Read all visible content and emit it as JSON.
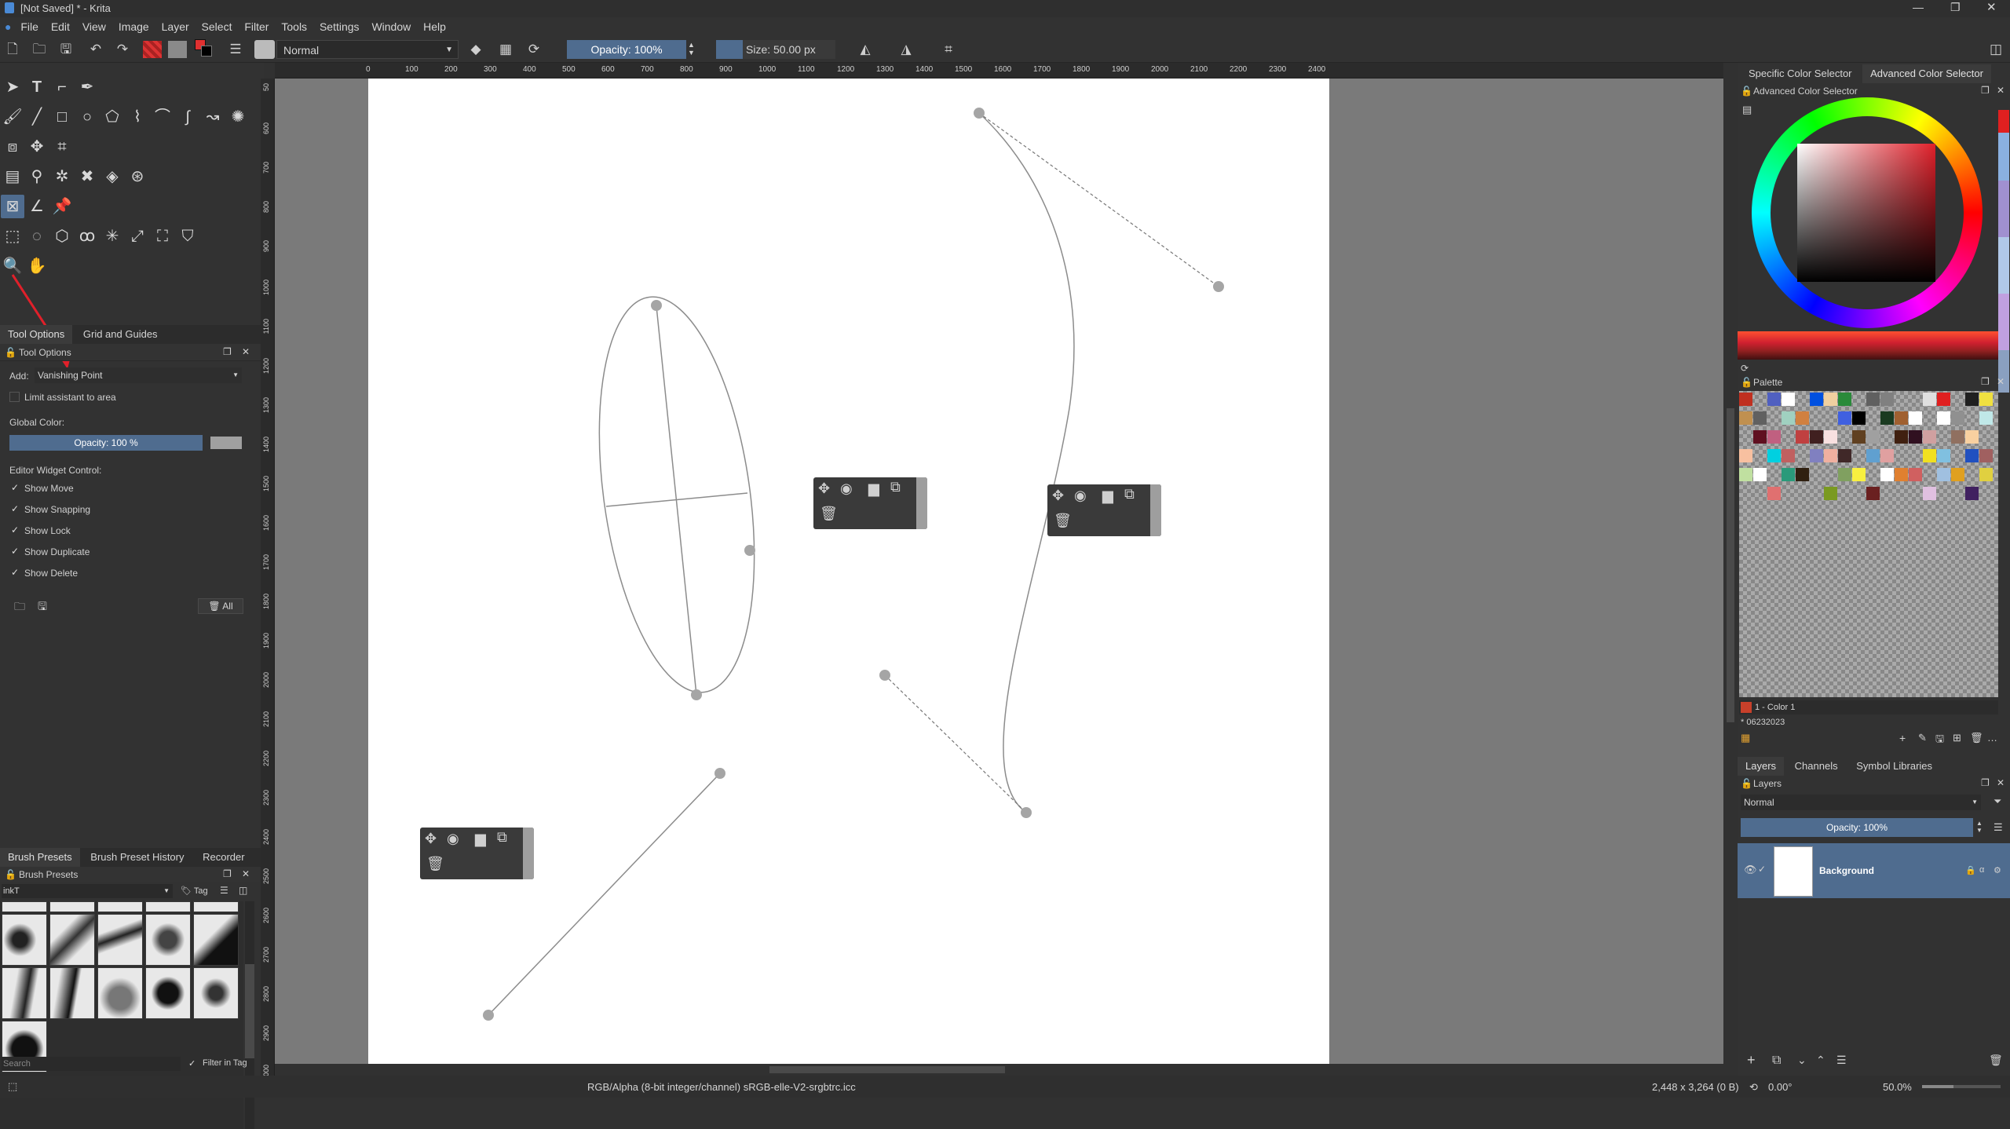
{
  "window": {
    "title": "[Not Saved] * - Krita"
  },
  "menu": [
    "File",
    "Edit",
    "View",
    "Image",
    "Layer",
    "Select",
    "Filter",
    "Tools",
    "Settings",
    "Window",
    "Help"
  ],
  "toolbar": {
    "blend_mode": "Normal",
    "opacity": "Opacity: 100%",
    "size": "Size: 50.00 px"
  },
  "left_tabs": {
    "tool_options": "Tool Options",
    "grid_guides": "Grid and Guides"
  },
  "tool_options": {
    "title": "Tool Options",
    "add_label": "Add:",
    "add_value": "Vanishing Point",
    "limit_label": "Limit assistant to area",
    "global_color_label": "Global Color:",
    "opacity_value": "Opacity: 100 %",
    "editor_widget_label": "Editor Widget Control:",
    "checks": [
      "Show Move",
      "Show Snapping",
      "Show Lock",
      "Show Duplicate",
      "Show Delete"
    ],
    "delete_all": "All"
  },
  "brush_tabs": [
    "Brush Presets",
    "Brush Preset History",
    "Recorder"
  ],
  "brush_presets": {
    "title": "Brush Presets",
    "filter_value": "inkT",
    "tag_label": "Tag",
    "search_placeholder": "Search",
    "filter_in_tag": "Filter in Tag"
  },
  "ruler_h": [
    "0",
    "100",
    "200",
    "300",
    "400",
    "500",
    "600",
    "700",
    "800",
    "900",
    "1000",
    "1100",
    "1200",
    "1300",
    "1400",
    "1500",
    "1600",
    "1700",
    "1800",
    "1900",
    "2000",
    "2100",
    "2200",
    "2300",
    "2400"
  ],
  "ruler_v": [
    "50",
    "600",
    "700",
    "800",
    "900",
    "1000",
    "1100",
    "1200",
    "1300",
    "1400",
    "1500",
    "1600",
    "1700",
    "1800",
    "1900",
    "2000",
    "2100",
    "2200",
    "2300",
    "2400",
    "2500",
    "2600",
    "2700",
    "2800",
    "2900",
    "3000"
  ],
  "right_tabs": {
    "specific": "Specific Color Selector",
    "advanced": "Advanced Color Selector"
  },
  "color_selector": {
    "title": "Advanced Color Selector"
  },
  "palette": {
    "title": "Palette",
    "color_name": "1 - Color 1",
    "palette_name": "* 06232023"
  },
  "layer_tabs": [
    "Layers",
    "Channels",
    "Symbol Libraries"
  ],
  "layers": {
    "title": "Layers",
    "blend_mode": "Normal",
    "opacity": "Opacity: 100%",
    "items": [
      {
        "name": "Background"
      }
    ]
  },
  "status": {
    "color_space": "RGB/Alpha (8-bit integer/channel)  sRGB-elle-V2-srgbtrc.icc",
    "dimensions": "2,448 x 3,264 (0 B)",
    "rotation": "0.00°",
    "zoom": "50.0%"
  },
  "colors": {
    "accent": "#4f6c8f",
    "fg": "#e03030",
    "bg": "#ffffff"
  }
}
